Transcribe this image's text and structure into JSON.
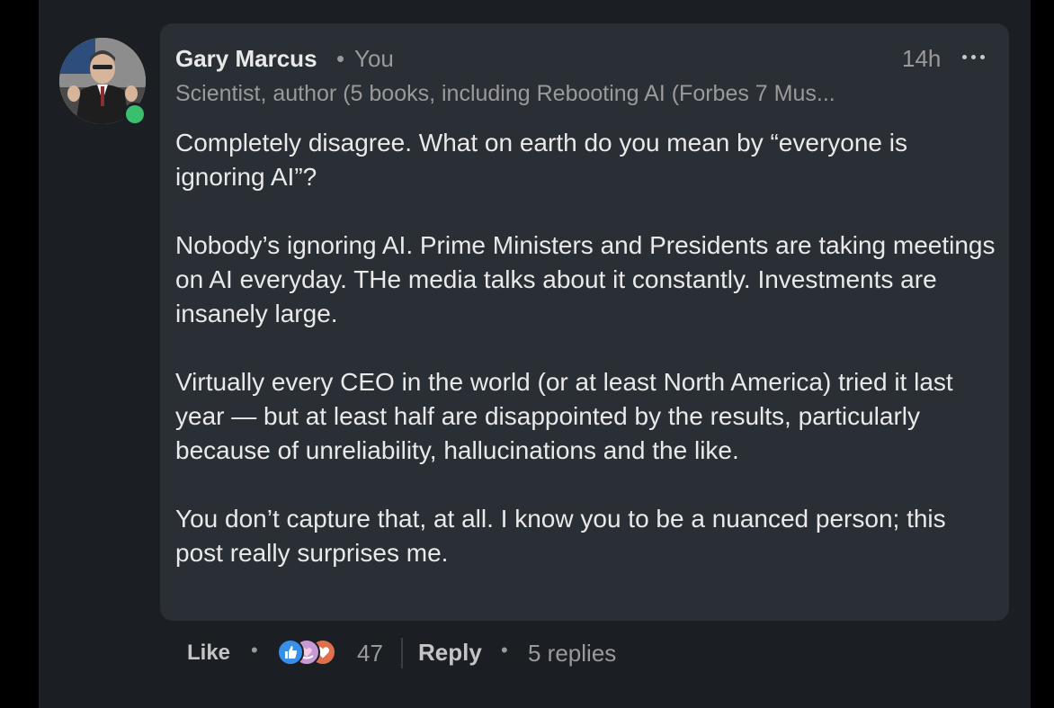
{
  "comment": {
    "author": {
      "name": "Gary Marcus",
      "separator": "•",
      "relation": "You",
      "headline": "Scientist, author (5 books, including Rebooting AI (Forbes 7 Mus...",
      "online_status_color": "#3bbf6e"
    },
    "timestamp": "14h",
    "more_icon": "more-horizontal-icon",
    "paragraphs": [
      "Completely disagree. What on earth do you mean by “everyone is ignoring AI”?",
      "Nobody’s ignoring AI. Prime Ministers and Presidents are taking meetings on AI everyday. THe media talks about it constantly. Investments are insanely large.",
      "Virtually every CEO in the world (or at least North America) tried it last year — but at least half are disappointed by the results, particularly because of unreliability, hallucinations and the like.",
      "You don’t capture that, at all. I know you to be a nuanced person; this post really surprises me."
    ]
  },
  "actions": {
    "like_label": "Like",
    "separator": "•",
    "reactions": [
      {
        "icon": "thumbs-up-icon",
        "color": "#378fe9"
      },
      {
        "icon": "support-icon",
        "color": "#c79ad6"
      },
      {
        "icon": "heart-icon",
        "color": "#df704d"
      }
    ],
    "reaction_count": "47",
    "reply_label": "Reply",
    "replies_label": "5 replies"
  },
  "colors": {
    "background": "#1b1f23",
    "bubble": "#2a2f35",
    "text": "#e9e9e9",
    "muted_text": "#9a9a9a"
  }
}
